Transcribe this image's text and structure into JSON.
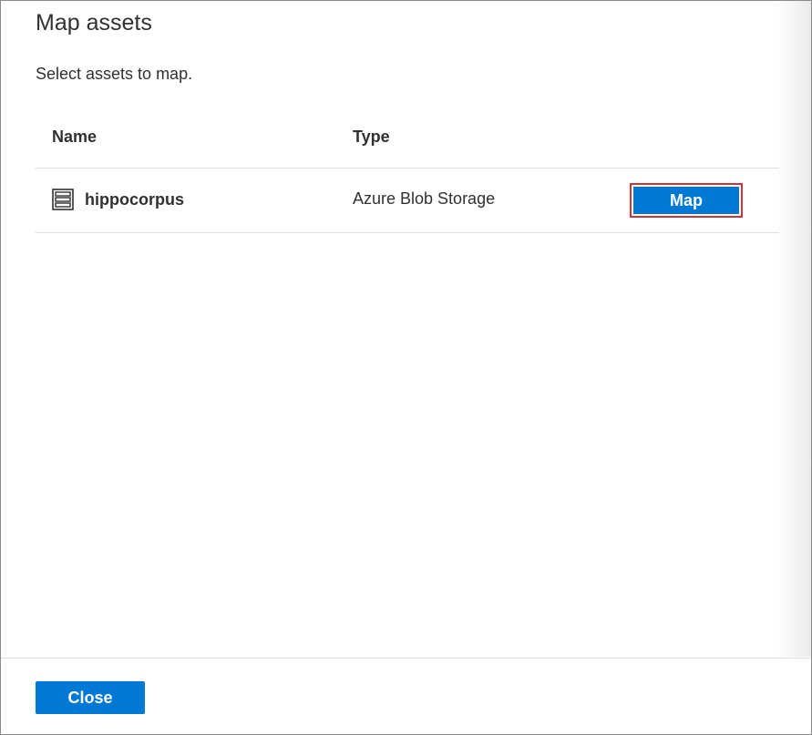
{
  "dialog": {
    "title": "Map assets",
    "subtitle": "Select assets to map."
  },
  "table": {
    "columns": [
      "Name",
      "Type"
    ],
    "rows": [
      {
        "name": "hippocorpus",
        "type": "Azure Blob Storage",
        "icon": "storage-container-icon",
        "action_label": "Map"
      }
    ]
  },
  "footer": {
    "close_label": "Close"
  },
  "colors": {
    "primary": "#0078d4",
    "highlight_border": "#d13438",
    "text": "#323130",
    "divider": "#e1dfdd"
  }
}
